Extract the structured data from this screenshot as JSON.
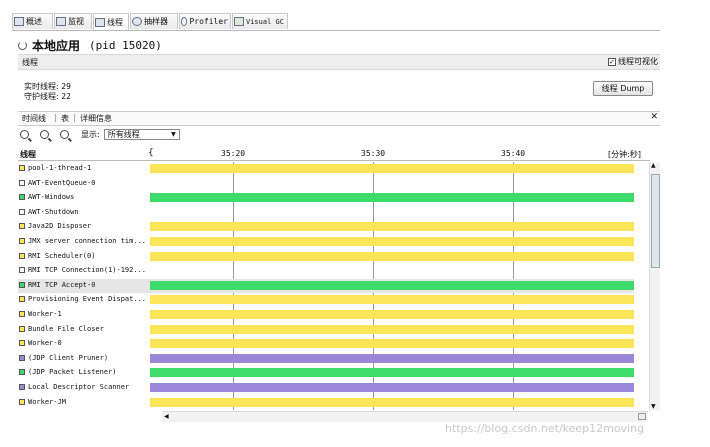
{
  "tabs": [
    {
      "label": "概述",
      "icon": "overview-icon"
    },
    {
      "label": "监视",
      "icon": "monitor-icon"
    },
    {
      "label": "线程",
      "icon": "threads-icon",
      "active": true
    },
    {
      "label": "抽样器",
      "icon": "sampler-icon"
    },
    {
      "label": "Profiler",
      "icon": "profiler-icon"
    },
    {
      "label": "Visual GC",
      "icon": "visual-gc-icon"
    }
  ],
  "header": {
    "title": "本地应用",
    "pid": "(pid 15020)"
  },
  "section": {
    "label": "线程",
    "checkbox_label": "线程可视化",
    "checked": true
  },
  "stats": {
    "live_label": "实时线程:",
    "live_value": "29",
    "daemon_label": "守护线程:",
    "daemon_value": "22"
  },
  "dump_button": "线程 Dump",
  "subtabs": [
    "时间线",
    "表",
    "详细信息"
  ],
  "toolbar": {
    "show_label": "显示:",
    "filter_value": "所有线程"
  },
  "timeline": {
    "column_label": "线程",
    "ticks": [
      "35:20",
      "35:30",
      "35:40"
    ],
    "unit": "[分钟:秒]"
  },
  "colors": {
    "running": "#3ddc6a",
    "sleeping": "#fde55a",
    "wait": "#9c88d8",
    "none": "#ffffff"
  },
  "threads": [
    {
      "name": "pool-1-thread-1",
      "state": "sleeping"
    },
    {
      "name": "AWT-EventQueue-0",
      "state": "none"
    },
    {
      "name": "AWT-Windows",
      "state": "running"
    },
    {
      "name": "AWT-Shutdown",
      "state": "none"
    },
    {
      "name": "Java2D Disposer",
      "state": "sleeping"
    },
    {
      "name": "JMX server connection tim...",
      "state": "sleeping"
    },
    {
      "name": "RMI Scheduler(0)",
      "state": "sleeping"
    },
    {
      "name": "RMI TCP Connection(1)-192...",
      "state": "none"
    },
    {
      "name": "RMI TCP Accept-0",
      "state": "running",
      "selected": true
    },
    {
      "name": "Provisioning Event Dispat...",
      "state": "sleeping"
    },
    {
      "name": "Worker-1",
      "state": "sleeping"
    },
    {
      "name": "Bundle File Closer",
      "state": "sleeping"
    },
    {
      "name": "Worker-0",
      "state": "sleeping"
    },
    {
      "name": "(JDP Client Pruner)",
      "state": "wait"
    },
    {
      "name": "(JDP Packet Listener)",
      "state": "running"
    },
    {
      "name": "Local Descriptor Scanner",
      "state": "wait"
    },
    {
      "name": "Worker-JM",
      "state": "sleeping"
    }
  ],
  "watermark": "https://blog.csdn.net/keep12moving"
}
